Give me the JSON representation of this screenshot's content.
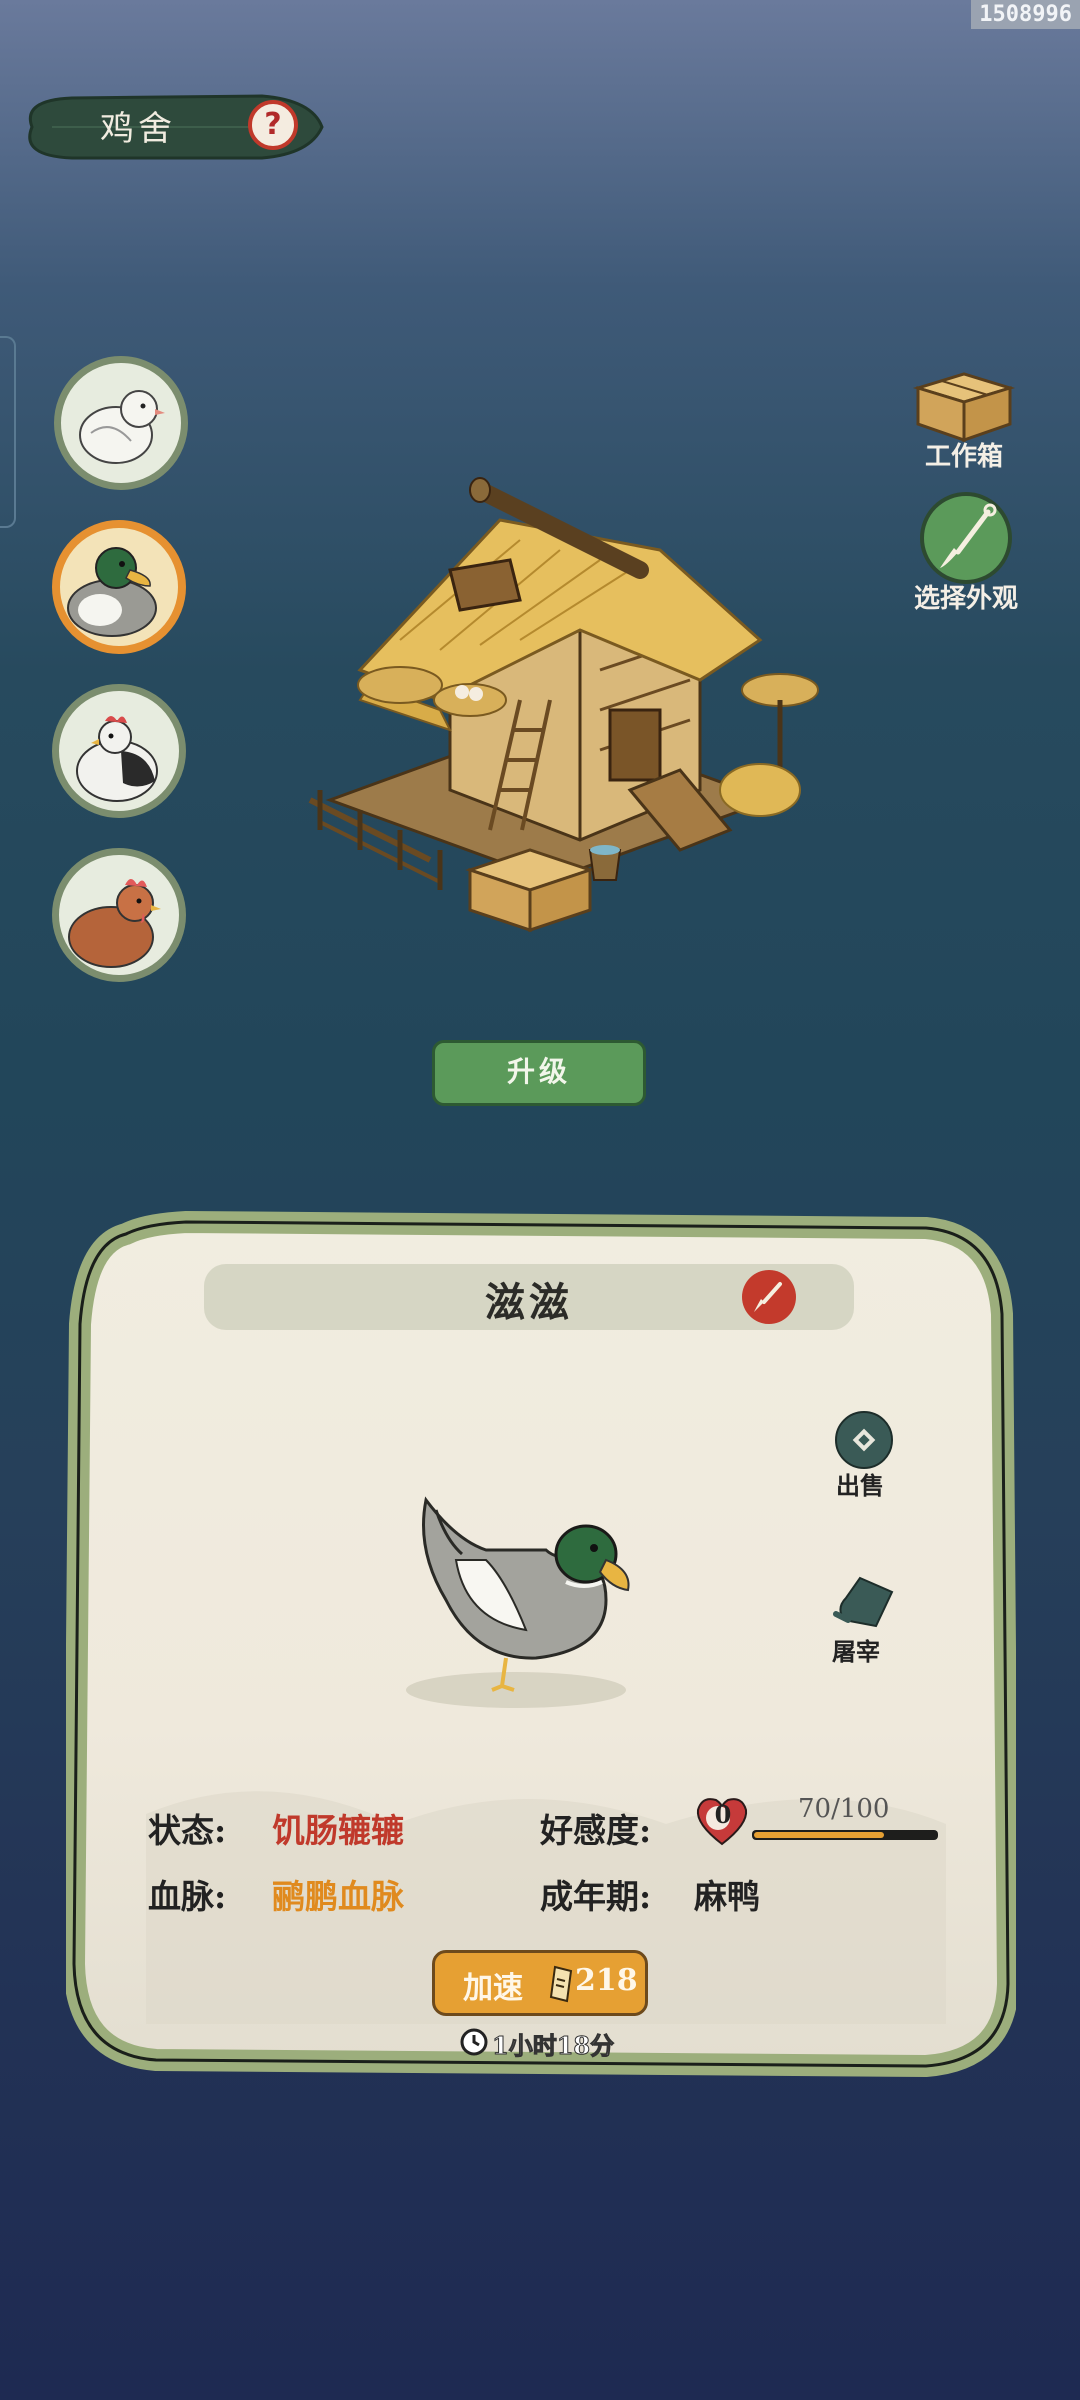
{
  "corner_id": "1508996",
  "header": {
    "title": "鸡舍",
    "help": "?"
  },
  "side_buttons": {
    "workbox": "工作箱",
    "appearance": "选择外观"
  },
  "coop": {
    "upgrade_label": "升级"
  },
  "avatars": [
    {
      "name": "white-pigeon",
      "selected": false
    },
    {
      "name": "mallard-duck",
      "selected": true
    },
    {
      "name": "black-white-chicken",
      "selected": false
    },
    {
      "name": "brown-hen",
      "selected": false
    }
  ],
  "panel": {
    "name": "滋滋",
    "sell_label": "出售",
    "slaughter_label": "屠宰",
    "status_label": "状态:",
    "status_value": "饥肠辘辘",
    "bloodline_label": "血脉:",
    "bloodline_value": "鹂鹏血脉",
    "affection_label": "好感度:",
    "affection_level": "0",
    "affection_progress": "70/100",
    "affection_fraction": 0.7,
    "adult_label": "成年期:",
    "adult_value": "麻鸭",
    "speedup_label": "加速",
    "speedup_cost": "218",
    "timer": "1小时18分"
  },
  "colors": {
    "accent_green": "#5b9a5a",
    "accent_orange": "#e6a033",
    "status_red": "#c0392b",
    "bloodline_orange": "#e08a1e"
  }
}
